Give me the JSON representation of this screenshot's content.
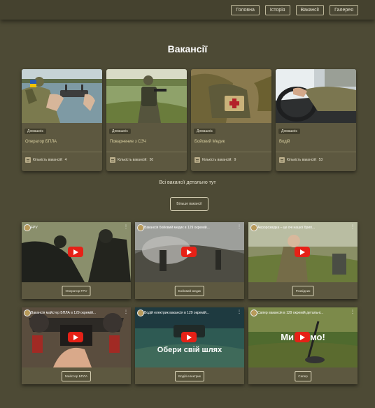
{
  "nav": [
    "Головна",
    "Історія",
    "Вакансії",
    "Галерея"
  ],
  "page_title": "Вакансії",
  "count_label": "Кількість вакансій:",
  "vacancies": [
    {
      "badge": "Домашніє",
      "title": "Оператор БПЛА",
      "count": "4"
    },
    {
      "badge": "Домашніє",
      "title": "Поварнение з СЗЧ",
      "count": "50"
    },
    {
      "badge": "Домашніє",
      "title": "Бойовий Медик",
      "count": "9"
    },
    {
      "badge": "Домашніє",
      "title": "Водій",
      "count": "53"
    }
  ],
  "all_text": "Всі вакансії детально тут",
  "more_button": "Більше вакансії",
  "videos": [
    {
      "title": "FPV",
      "button": "Оператор FPV",
      "overlay": ""
    },
    {
      "title": "Вакансія бойовий медик в 129 окремій...",
      "button": "Бойовий медик",
      "overlay": ""
    },
    {
      "title": "Аеророзвідка – це очі нашої бригі...",
      "button": "Розвідник",
      "overlay": ""
    },
    {
      "title": "Вакансія майстер БПЛА в 129 окремій...",
      "button": "Майстер БПЛА",
      "overlay": ""
    },
    {
      "title": "Водій електрик вакансія в 129 окремій...",
      "button": "Водій електрик",
      "overlay": "Обери свій шлях"
    },
    {
      "title": "Сапер вакансія в 129 окремій детальні...",
      "button": "Сапер",
      "overlay": "Ми н   имо!"
    }
  ]
}
